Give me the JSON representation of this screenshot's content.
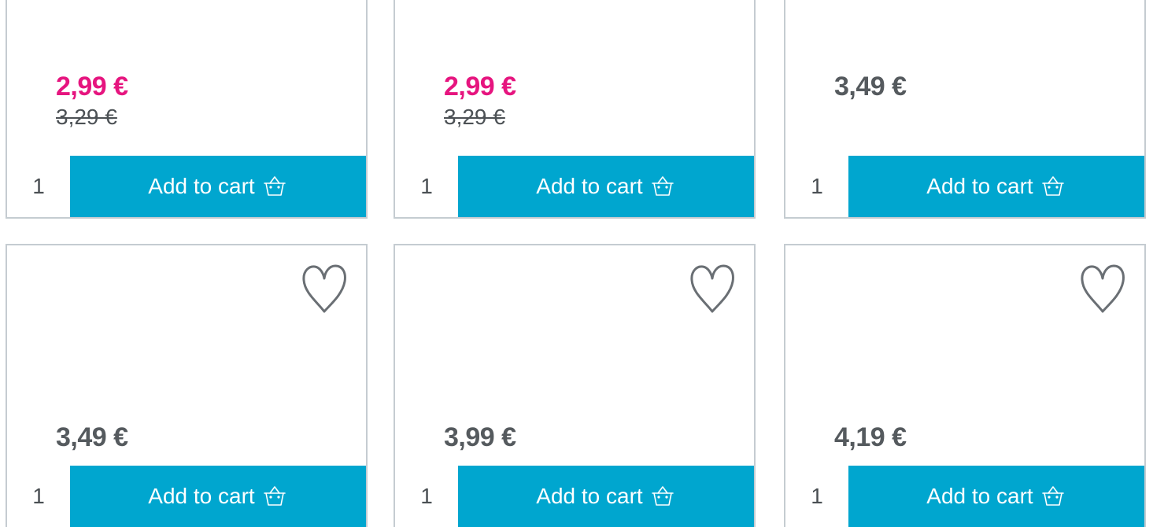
{
  "products": [
    {
      "price": "2,99 €",
      "old_price": "3,29 €",
      "qty": "1",
      "add_label": "Add to cart"
    },
    {
      "price": "2,99 €",
      "old_price": "3,29 €",
      "qty": "1",
      "add_label": "Add to cart"
    },
    {
      "price": "3,49 €",
      "old_price": "",
      "qty": "1",
      "add_label": "Add to cart"
    },
    {
      "price": "3,49 €",
      "old_price": "",
      "qty": "1",
      "add_label": "Add to cart",
      "wishlist_icon": "heart-icon"
    },
    {
      "price": "3,99 €",
      "old_price": "",
      "qty": "1",
      "add_label": "Add to cart",
      "wishlist_icon": "heart-icon"
    },
    {
      "price": "4,19 €",
      "old_price": "",
      "qty": "1",
      "add_label": "Add to cart",
      "wishlist_icon": "heart-icon"
    }
  ],
  "colors": {
    "sale_price": "#e6157f",
    "regular_price": "#555a5e",
    "button": "#00a6cf",
    "border": "#c5ccd1"
  },
  "icons": {
    "cart": "basket-icon",
    "wishlist": "heart-icon"
  }
}
